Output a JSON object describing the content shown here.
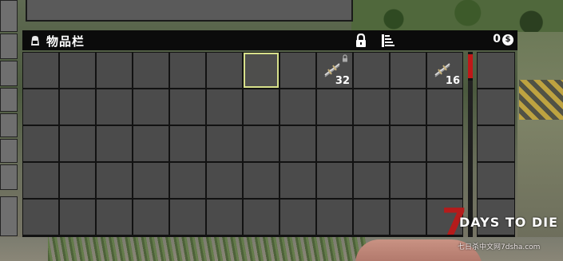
{
  "inventory": {
    "title": "物品栏",
    "title_icon": "backpack-icon",
    "lock_icon": "padlock-icon",
    "sort_icon": "sort-stack-icon",
    "currency": {
      "amount": "0",
      "symbol": "$",
      "icon": "coin-icon"
    },
    "selected_slot": 6,
    "slots": [
      {
        "index": 8,
        "item_icon": "barbed-wire-icon",
        "count": "32",
        "locked": true
      },
      {
        "index": 11,
        "item_icon": "barbed-wire-icon",
        "count": "16",
        "locked": false
      }
    ],
    "durability_color": "#c01818",
    "selection_color": "#d7e08a"
  },
  "watermark": {
    "numeral": "7",
    "game_name": "DAYS TO DIE",
    "site": "七日杀中文网7dsha.com"
  }
}
